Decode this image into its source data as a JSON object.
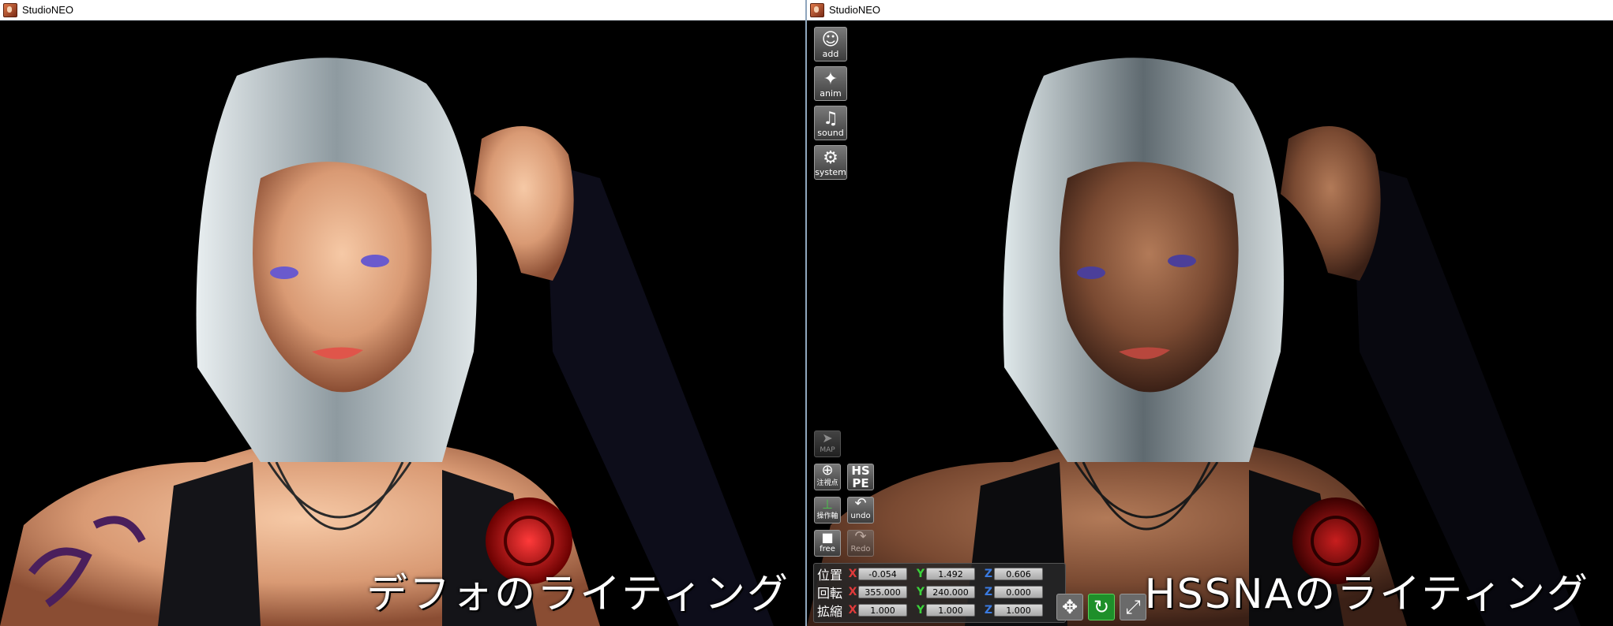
{
  "left_window": {
    "title": "StudioNEO",
    "caption": "デフォのライティング"
  },
  "right_window": {
    "title": "StudioNEO",
    "caption": "HSSNAのライティング",
    "side_menu": {
      "add_label": "add",
      "anim_label": "anim",
      "sound_label": "sound",
      "system_label": "system"
    },
    "tools": {
      "map_label": "MAP",
      "look_point_label": "注視点",
      "hspe_label": "HS PE",
      "axis_label": "操作軸",
      "undo_label": "undo",
      "free_label": "free",
      "redo_label": "Redo"
    },
    "transform": {
      "axis_x": "X",
      "axis_y": "Y",
      "axis_z": "Z",
      "position": {
        "label": "位置",
        "x": "-0.054",
        "y": "1.492",
        "z": "0.606"
      },
      "rotation": {
        "label": "回転",
        "x": "355.000",
        "y": "240.000",
        "z": "0.000"
      },
      "scale": {
        "label": "拡縮",
        "x": "1.000",
        "y": "1.000",
        "z": "1.000"
      }
    },
    "gizmo_icons": [
      "move-icon",
      "rotate-icon",
      "scale-icon"
    ]
  }
}
